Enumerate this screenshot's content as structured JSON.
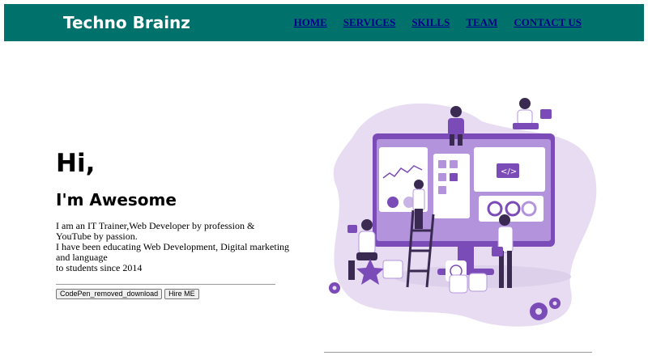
{
  "header": {
    "brand": "Techno Brainz",
    "nav": [
      "HOME",
      "SERVICES",
      "SKILLS",
      "TEAM",
      "CONTACT US"
    ]
  },
  "hero": {
    "greeting": "Hi,",
    "subtitle": "I'm Awesome",
    "description": [
      "I am an IT Trainer,Web Developer by profession & YouTube by passion.",
      "I have been educating Web Development, Digital marketing and language",
      "to students since 2014"
    ],
    "buttons": {
      "download": "CodePen_removed_download",
      "hire": "Hire ME"
    }
  },
  "colors": {
    "header_bg": "#00716b",
    "nav_link": "#00008b",
    "accent_purple": "#7b4bb7",
    "blob_lavender": "#e7dcf1"
  }
}
